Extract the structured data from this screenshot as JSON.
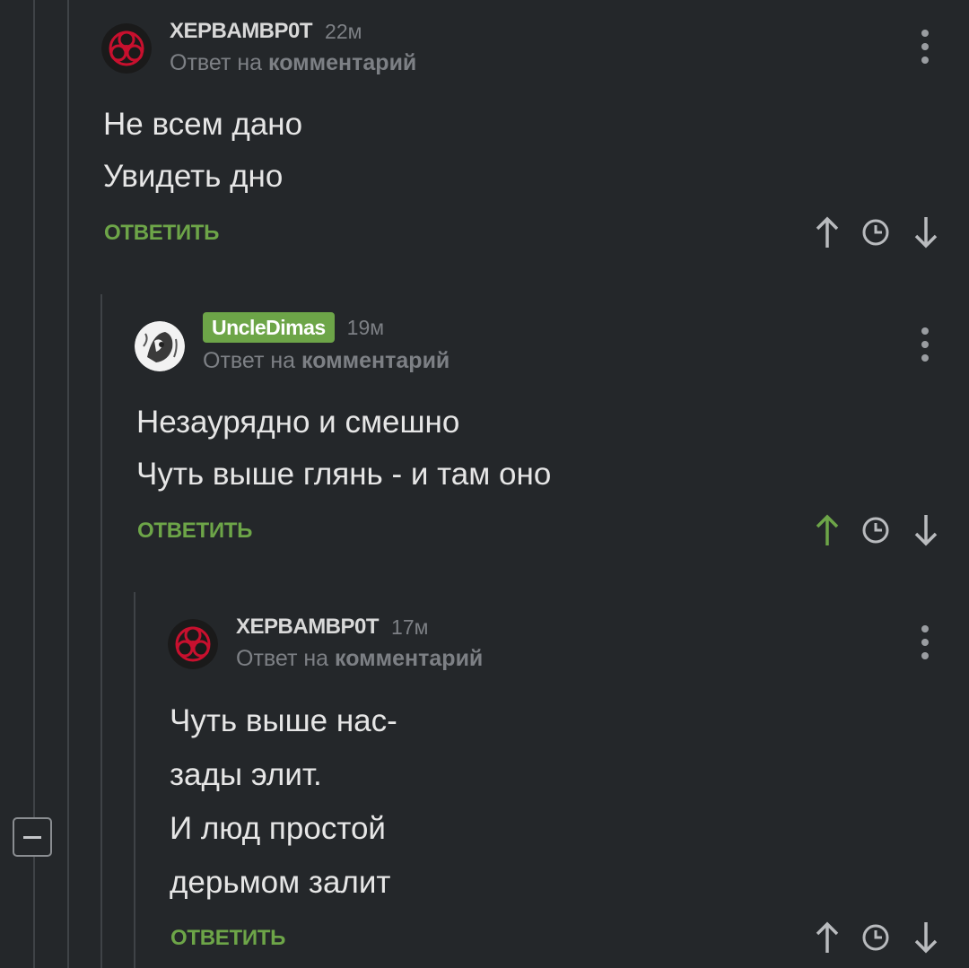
{
  "comments": [
    {
      "username": "XEPBAMBP0T",
      "time": "22м",
      "reply_prefix": "Ответ на",
      "reply_target": "комментарий",
      "lines": [
        "Не всем дано",
        "Увидеть дно"
      ],
      "reply_label": "ОТВЕТИТЬ",
      "avatar_icon": "biohazard-icon",
      "upvoted": false
    },
    {
      "username": "UncleDimas",
      "time": "19м",
      "reply_prefix": "Ответ на",
      "reply_target": "комментарий",
      "lines": [
        "Незаурядно и смешно",
        "Чуть выше глянь - и там оно"
      ],
      "reply_label": "ОТВЕТИТЬ",
      "avatar_icon": "sketch-avatar-icon",
      "upvoted": true
    },
    {
      "username": "XEPBAMBP0T",
      "time": "17м",
      "reply_prefix": "Ответ на",
      "reply_target": "комментарий",
      "lines": [
        "Чуть выше нас-",
        "зады элит.",
        "И люд простой",
        "дерьмом залит"
      ],
      "reply_label": "ОТВЕТИТЬ",
      "avatar_icon": "biohazard-icon",
      "upvoted": false
    }
  ],
  "icons": {
    "upvote": "arrow-up-icon",
    "time": "clock-icon",
    "downvote": "arrow-down-icon",
    "menu": "more-vertical-icon",
    "collapse": "minus-icon"
  },
  "colors": {
    "background": "#24272a",
    "accent_green": "#6da548",
    "text": "#e6e6e6",
    "muted": "#7d8085",
    "thread_line": "#3f4347",
    "biohazard_red": "#c8102e"
  }
}
